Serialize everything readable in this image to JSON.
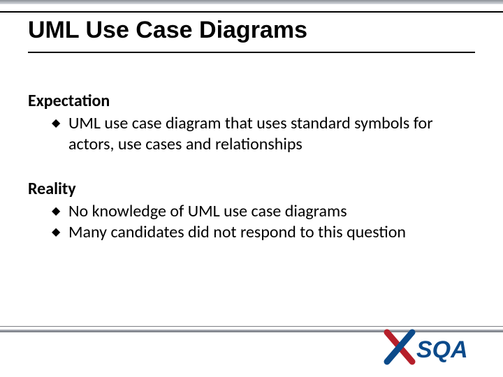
{
  "title": "UML Use Case Diagrams",
  "sections": [
    {
      "heading": "Expectation",
      "bullets": [
        "UML use case diagram that uses standard symbols for actors, use cases and relationships"
      ]
    },
    {
      "heading": "Reality",
      "bullets": [
        "No knowledge of UML use case diagrams",
        "Many candidates did not respond to this question"
      ]
    }
  ],
  "bullet_glyph": "◆",
  "logo": {
    "text": "SQA",
    "accent_color": "#0b4a8a",
    "cross_color": "#b51f2a"
  }
}
